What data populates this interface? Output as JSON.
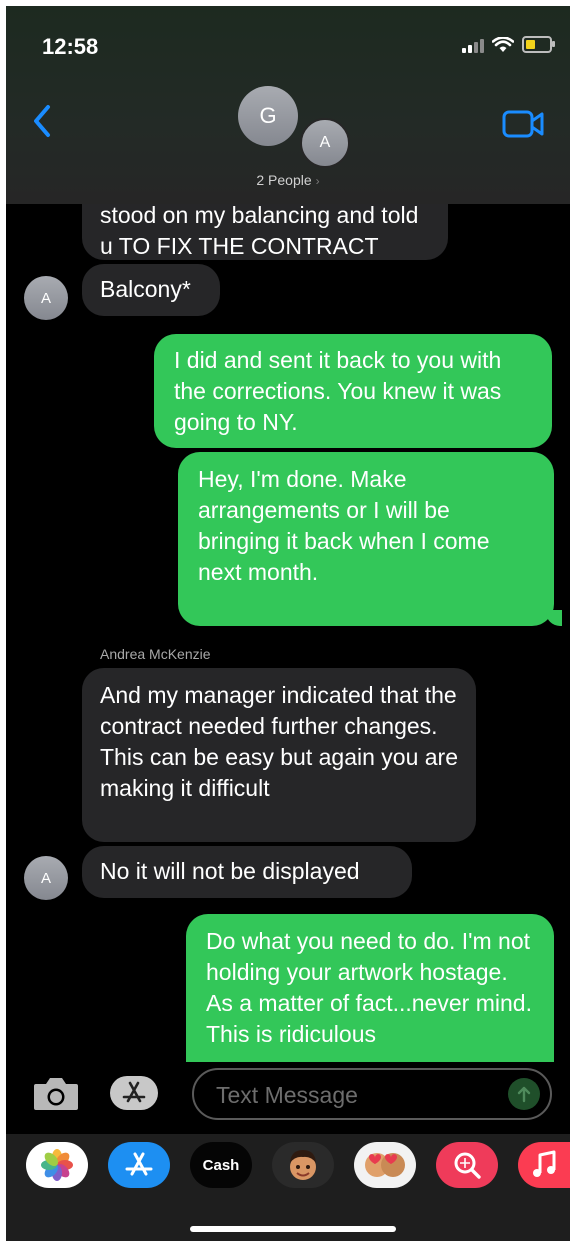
{
  "status_bar": {
    "time": "12:58"
  },
  "header": {
    "group_avatar_letter": "G",
    "member_avatar_letter": "A",
    "people_label": "2 People",
    "people_chevron": "›"
  },
  "messages": [
    {
      "dir": "in",
      "text": "stood on my balancing and told u TO FIX THE CONTRACT"
    },
    {
      "dir": "in",
      "text": "Balcony*",
      "avatar": "A"
    },
    {
      "dir": "out",
      "text": "I did and sent it back to you with the corrections. You knew it was going to NY."
    },
    {
      "dir": "out",
      "text": "Hey, I'm done. Make arrangements or I will be bringing it back when I come next month."
    },
    {
      "sender": "Andrea McKenzie"
    },
    {
      "dir": "in",
      "text": "And my manager indicated that the contract needed further changes. This can be easy but again you are making it difficult"
    },
    {
      "dir": "in",
      "text": "No it will not be displayed",
      "avatar": "A"
    },
    {
      "dir": "out",
      "text": "Do what you need to do. I'm not holding your artwork hostage. As a matter of fact...never mind. This is ridiculous"
    }
  ],
  "input": {
    "placeholder": "Text Message"
  },
  "tray": {
    "cash_label": "Cash",
    "cash_glyph": ""
  },
  "colors": {
    "outgoing": "#33c759",
    "incoming": "#262628",
    "accent": "#1a8cff"
  },
  "icons": [
    "back-chevron-icon",
    "video-camera-icon",
    "camera-icon",
    "app-store-icon",
    "send-arrow-icon",
    "photos-icon",
    "memoji-icon",
    "search-icon",
    "music-icon"
  ]
}
